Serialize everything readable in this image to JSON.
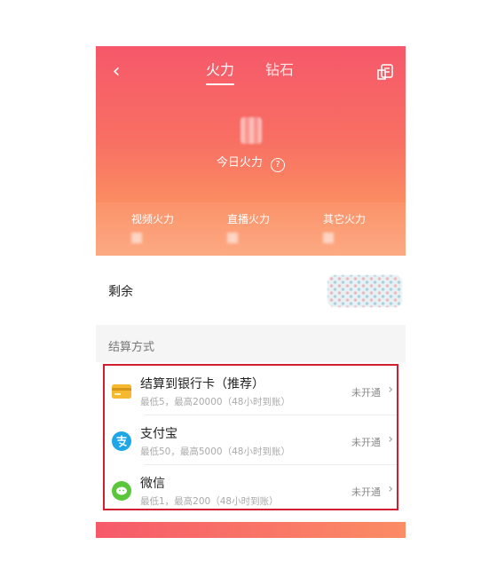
{
  "header": {
    "back_glyph": "‹",
    "tabs": [
      {
        "label": "火力",
        "active": true
      },
      {
        "label": "钻石",
        "active": false
      }
    ],
    "corner_icon": "receipt-icon"
  },
  "hero": {
    "today_label": "今日火力",
    "help_glyph": "?",
    "stats": [
      {
        "label": "视频火力"
      },
      {
        "label": "直播火力"
      },
      {
        "label": "其它火力"
      }
    ]
  },
  "balance": {
    "label": "剩余"
  },
  "settlement": {
    "section_title": "结算方式",
    "methods": [
      {
        "title": "结算到银行卡（推荐）",
        "subtitle": "最低5，最高20000（48小时到账）",
        "status": "未开通",
        "icon": "bank-card-icon",
        "color": "#f5b92f"
      },
      {
        "title": "支付宝",
        "subtitle": "最低50，最高5000（48小时到账）",
        "status": "未开通",
        "icon": "alipay-icon",
        "color": "#1ea6e6"
      },
      {
        "title": "微信",
        "subtitle": "最低1，最高200（48小时到账）",
        "status": "未开通",
        "icon": "wechat-icon",
        "color": "#5ac73a"
      }
    ],
    "chevron": "›"
  },
  "colors": {
    "hero_top": "#f6586a",
    "hero_bottom": "#fca57c",
    "highlight_border": "#d01f2f"
  }
}
